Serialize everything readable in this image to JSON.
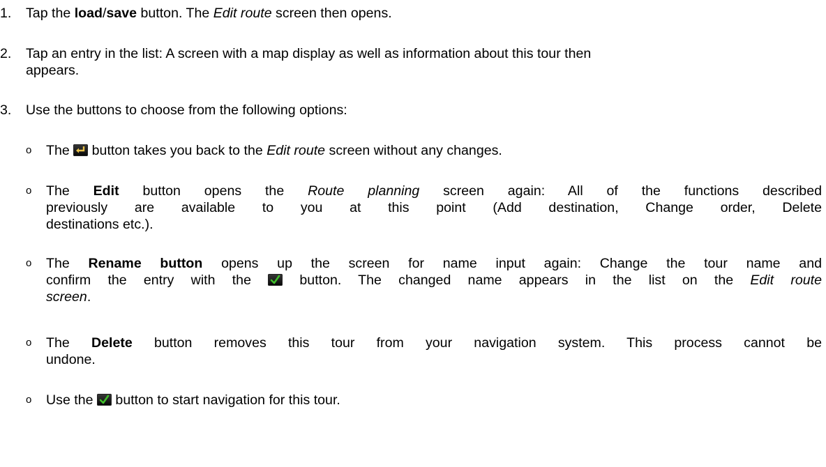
{
  "steps": [
    {
      "number": "1.",
      "parts": [
        "Tap the ",
        "load",
        "/",
        "save",
        " button. The ",
        "Edit route",
        " screen then opens."
      ]
    },
    {
      "number": "2.",
      "line1": "Tap an entry in the list: A screen with a map display as well as information about this tour then",
      "line2": "appears."
    },
    {
      "number": "3.",
      "text": "Use the buttons to choose from the following options:"
    }
  ],
  "bullets": [
    {
      "mark": "o",
      "parts": [
        "The ",
        " button takes you back to the ",
        "Edit route",
        " screen without any changes."
      ],
      "icon": "back-arrow-icon"
    },
    {
      "mark": "o",
      "line1": [
        "The ",
        "Edit",
        " button opens the ",
        "Route planning",
        " screen again: All of the functions described"
      ],
      "line2": "previously are available to you at this point (Add destination, Change order, Delete",
      "line3": "destinations etc.)."
    },
    {
      "mark": "o",
      "line1": [
        "The ",
        "Rename button",
        " opens up the screen for name input again: Change the tour name and"
      ],
      "line2": [
        "confirm the entry with the ",
        " button. The changed name appears in the list on the ",
        "Edit route"
      ],
      "line3": "screen",
      "line3_end": ".",
      "icon": "checkmark-icon"
    },
    {
      "mark": "o",
      "line1": [
        "The ",
        "Delete",
        " button removes this tour from your navigation system. This process cannot be"
      ],
      "line2": "undone."
    },
    {
      "mark": "o",
      "parts": [
        "Use the ",
        " button to start navigation for this tour."
      ],
      "icon": "checkmark-icon"
    }
  ],
  "colors": {
    "text": "#000000",
    "icon_bg": "#1a1a1a",
    "check": "#3fbf2a",
    "arrow": "#e9c24a"
  }
}
